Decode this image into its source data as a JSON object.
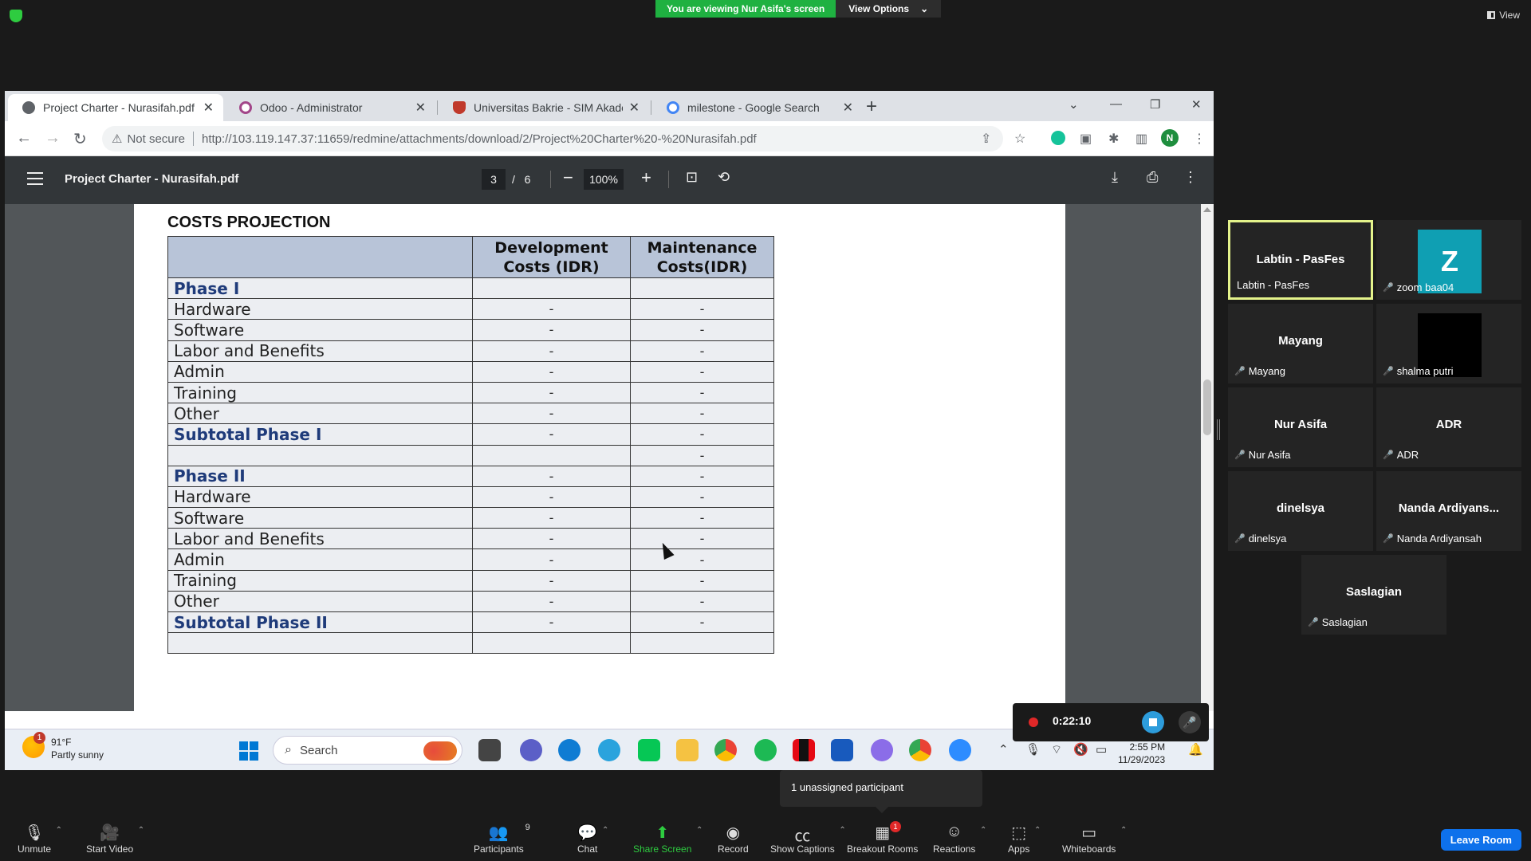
{
  "zoom_top": {
    "viewing_text": "You are viewing Nur Asifa's screen",
    "view_options": "View Options",
    "view_label": "View"
  },
  "chrome": {
    "tabs": [
      {
        "label": "Project Charter - Nurasifah.pdf",
        "active": true,
        "favicon_color": "#5f6368"
      },
      {
        "label": "Odoo - Administrator",
        "active": false,
        "favicon_color": "#a24689"
      },
      {
        "label": "Universitas Bakrie - SIM Akadem",
        "active": false,
        "favicon_color": "#c0392b"
      },
      {
        "label": "milestone - Google Search",
        "active": false,
        "favicon_color": "#4285f4"
      }
    ],
    "not_secure": "Not secure",
    "url": "http://103.119.147.37:11659/redmine/attachments/download/2/Project%20Charter%20-%20Nurasifah.pdf",
    "profile_initial": "N"
  },
  "pdf": {
    "title": "Project Charter - Nurasifah.pdf",
    "page": "3",
    "total": "6",
    "zoom": "100%",
    "heading": "COSTS PROJECTION",
    "columns": [
      "",
      "Development\nCosts (IDR)",
      "Maintenance\nCosts(IDR)"
    ],
    "rows": [
      {
        "label": "Phase I",
        "dev": "",
        "maint": "",
        "phase": true
      },
      {
        "label": "Hardware",
        "dev": "-",
        "maint": "-"
      },
      {
        "label": "Software",
        "dev": "-",
        "maint": "-"
      },
      {
        "label": "Labor and Benefits",
        "dev": "-",
        "maint": "-"
      },
      {
        "label": "Admin",
        "dev": "-",
        "maint": "-"
      },
      {
        "label": "Training",
        "dev": "-",
        "maint": "-"
      },
      {
        "label": "Other",
        "dev": "-",
        "maint": "-"
      },
      {
        "label": "Subtotal Phase I",
        "dev": "-",
        "maint": "-",
        "phase": true
      },
      {
        "label": "",
        "dev": "",
        "maint": "-"
      },
      {
        "label": "Phase II",
        "dev": "-",
        "maint": "-",
        "phase": true
      },
      {
        "label": "Hardware",
        "dev": "-",
        "maint": "-"
      },
      {
        "label": "Software",
        "dev": "-",
        "maint": "-"
      },
      {
        "label": "Labor and Benefits",
        "dev": "-",
        "maint": "-"
      },
      {
        "label": "Admin",
        "dev": "-",
        "maint": "-"
      },
      {
        "label": "Training",
        "dev": "-",
        "maint": "-"
      },
      {
        "label": "Other",
        "dev": "-",
        "maint": "-"
      },
      {
        "label": "Subtotal Phase II",
        "dev": "-",
        "maint": "-",
        "phase": true
      },
      {
        "label": "",
        "dev": "",
        "maint": ""
      }
    ]
  },
  "taskbar": {
    "weather_temp": "91°F",
    "weather_desc": "Partly sunny",
    "weather_badge": "1",
    "search": "Search",
    "date": "11/29/2023",
    "time": "2:55 PM"
  },
  "recording": {
    "time": "0:22:10"
  },
  "participants": [
    {
      "name": "Labtin - PasFes",
      "label": "Labtin - PasFes",
      "muted": false,
      "active": true,
      "avatar": ""
    },
    {
      "name": "",
      "label": "zoom baa04",
      "muted": true,
      "active": false,
      "avatar": "Z",
      "avatar_color": "#0f9fb3"
    },
    {
      "name": "Mayang",
      "label": "Mayang",
      "muted": true,
      "active": false,
      "avatar": ""
    },
    {
      "name": "",
      "label": "shalma putri",
      "muted": true,
      "active": false,
      "avatar": " ",
      "avatar_color": "#000000"
    },
    {
      "name": "Nur Asifa",
      "label": "Nur Asifa",
      "muted": true,
      "active": false,
      "avatar": ""
    },
    {
      "name": "ADR",
      "label": "ADR",
      "muted": true,
      "active": false,
      "avatar": ""
    },
    {
      "name": "dinelsya",
      "label": "dinelsya",
      "muted": true,
      "active": false,
      "avatar": ""
    },
    {
      "name": "Nanda Ardiyans...",
      "label": "Nanda Ardiyansah",
      "muted": true,
      "active": false,
      "avatar": ""
    },
    {
      "name": "Saslagian",
      "label": "Saslagian",
      "muted": true,
      "active": false,
      "avatar": ""
    }
  ],
  "unassigned": "1 unassigned participant",
  "toolbar": {
    "unmute": "Unmute",
    "start_video": "Start Video",
    "participants": "Participants",
    "participants_count": "9",
    "chat": "Chat",
    "share_screen": "Share Screen",
    "record": "Record",
    "show_captions": "Show Captions",
    "breakout_rooms": "Breakout Rooms",
    "breakout_badge": "1",
    "reactions": "Reactions",
    "apps": "Apps",
    "whiteboards": "Whiteboards",
    "leave_room": "Leave Room"
  },
  "colors": {
    "zoom_green": "#1fb141",
    "active_speaker": "#e4f38b",
    "leave_blue": "#0e71eb",
    "table_header": "#b8c4d8",
    "phase_text": "#1f3b7a"
  }
}
